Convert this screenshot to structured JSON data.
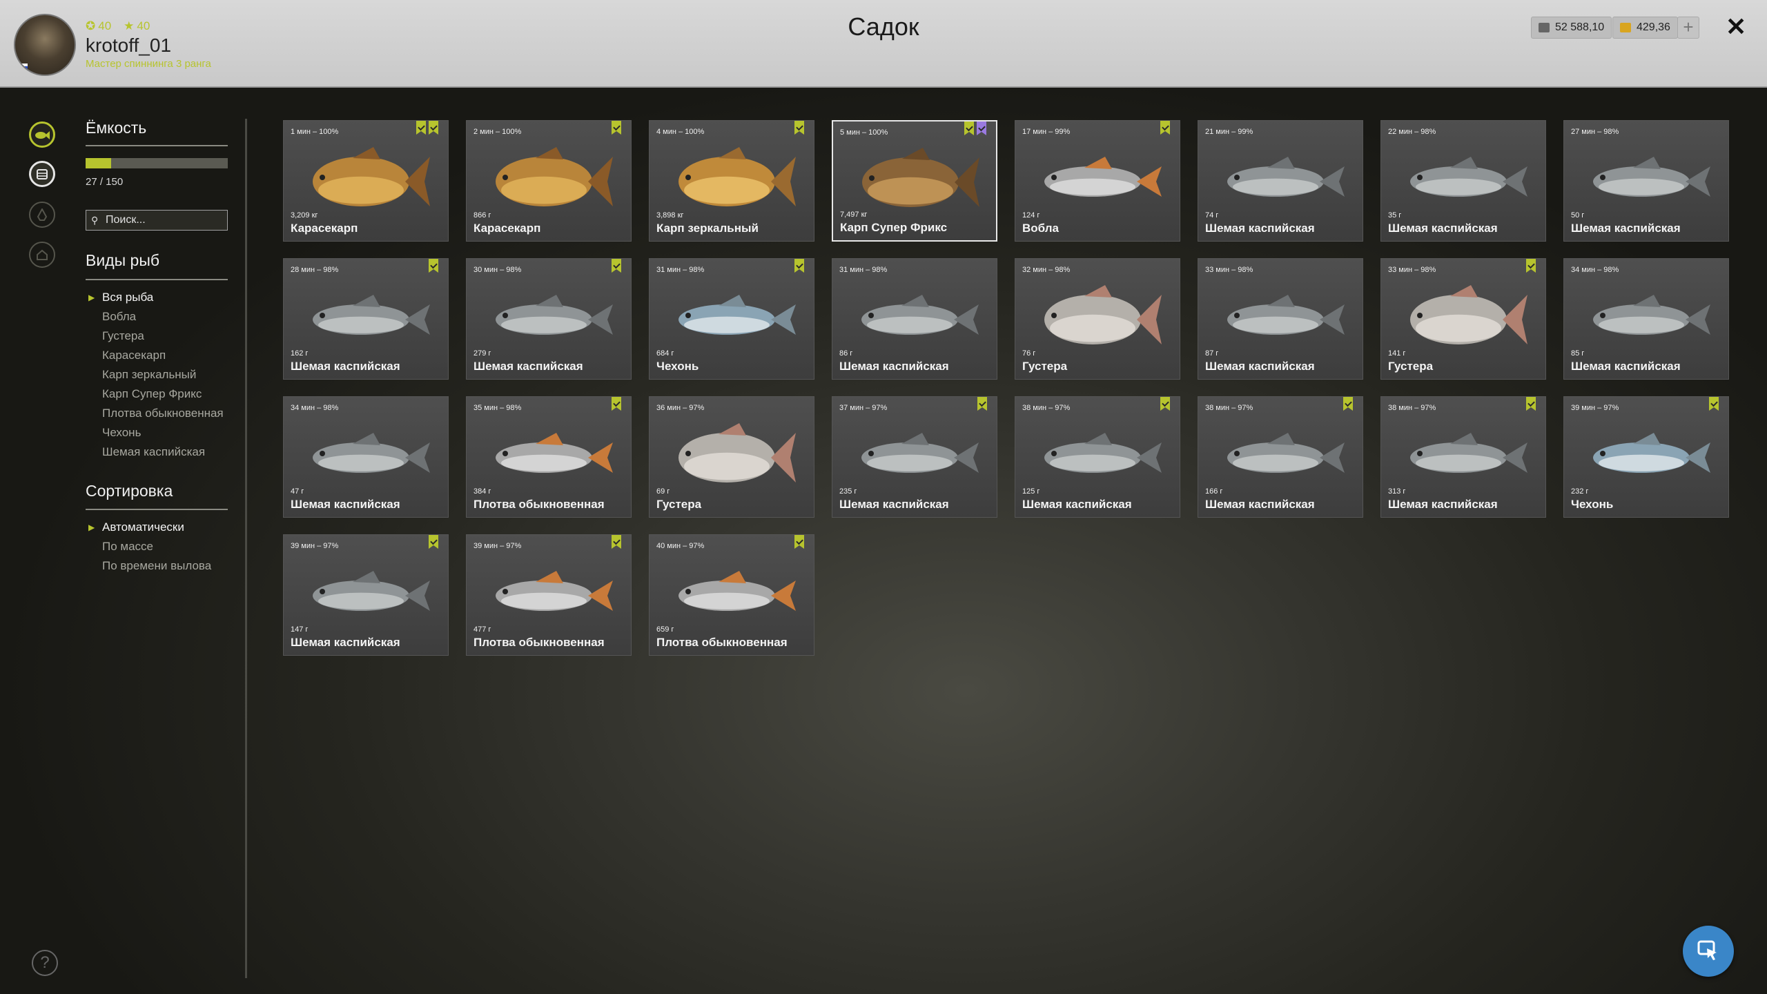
{
  "header": {
    "title": "Садок",
    "username": "krotoff_01",
    "rank": "Мастер спиннинга 3 ранга",
    "stat_level": "40",
    "stat_stars": "40",
    "silver": "52 588,10",
    "gold": "429,36",
    "plus_label": "+",
    "close_label": "✕"
  },
  "sidebar": {
    "capacity_title": "Ёмкость",
    "capacity_text": "27 / 150",
    "capacity_fraction": 0.18,
    "search_placeholder": "Поиск...",
    "species_title": "Виды рыб",
    "species": [
      {
        "label": "Вся рыба",
        "active": true
      },
      {
        "label": "Вобла",
        "active": false
      },
      {
        "label": "Густера",
        "active": false
      },
      {
        "label": "Карасекарп",
        "active": false
      },
      {
        "label": "Карп зеркальный",
        "active": false
      },
      {
        "label": "Карп Супер Фрикс",
        "active": false
      },
      {
        "label": "Плотва обыкновенная",
        "active": false
      },
      {
        "label": "Чехонь",
        "active": false
      },
      {
        "label": "Шемая каспийская",
        "active": false
      }
    ],
    "sort_title": "Сортировка",
    "sort": [
      {
        "label": "Автоматически",
        "active": true
      },
      {
        "label": "По массе",
        "active": false
      },
      {
        "label": "По времени вылова",
        "active": false
      }
    ]
  },
  "icons": {
    "rail": [
      "fish-icon",
      "keepnet-icon",
      "fire-icon",
      "home-icon"
    ],
    "help": "?",
    "fab": "cursor-icon"
  },
  "colors": {
    "accent": "#b7c42e",
    "badge_purple": "#9a7ae0",
    "fab": "#3a86c8"
  },
  "fish": [
    {
      "time": "1 мин – 100%",
      "weight": "3,209 кг",
      "name": "Карасекарп",
      "kind": "carp",
      "badges": [
        "green",
        "gold"
      ]
    },
    {
      "time": "2 мин – 100%",
      "weight": "866 г",
      "name": "Карасекарп",
      "kind": "carp",
      "badges": [
        "green"
      ]
    },
    {
      "time": "4 мин – 100%",
      "weight": "3,898 кг",
      "name": "Карп зеркальный",
      "kind": "mirror",
      "badges": [
        "green"
      ]
    },
    {
      "time": "5 мин – 100%",
      "weight": "7,497 кг",
      "name": "Карп Супер Фрикс",
      "kind": "frix",
      "badges": [
        "green",
        "purple"
      ],
      "selected": true
    },
    {
      "time": "17 мин – 99%",
      "weight": "124 г",
      "name": "Вобла",
      "kind": "roach",
      "badges": [
        "green"
      ]
    },
    {
      "time": "21 мин – 99%",
      "weight": "74 г",
      "name": "Шемая каспийская",
      "kind": "shemaya",
      "badges": []
    },
    {
      "time": "22 мин – 98%",
      "weight": "35 г",
      "name": "Шемая каспийская",
      "kind": "shemaya",
      "badges": []
    },
    {
      "time": "27 мин – 98%",
      "weight": "50 г",
      "name": "Шемая каспийская",
      "kind": "shemaya",
      "badges": []
    },
    {
      "time": "28 мин – 98%",
      "weight": "162 г",
      "name": "Шемая каспийская",
      "kind": "shemaya",
      "badges": [
        "green"
      ]
    },
    {
      "time": "30 мин – 98%",
      "weight": "279 г",
      "name": "Шемая каспийская",
      "kind": "shemaya",
      "badges": [
        "green"
      ]
    },
    {
      "time": "31 мин – 98%",
      "weight": "684 г",
      "name": "Чехонь",
      "kind": "chekhon",
      "badges": [
        "green"
      ]
    },
    {
      "time": "31 мин – 98%",
      "weight": "86 г",
      "name": "Шемая каспийская",
      "kind": "shemaya",
      "badges": []
    },
    {
      "time": "32 мин – 98%",
      "weight": "76 г",
      "name": "Густера",
      "kind": "bream",
      "badges": []
    },
    {
      "time": "33 мин – 98%",
      "weight": "87 г",
      "name": "Шемая каспийская",
      "kind": "shemaya",
      "badges": []
    },
    {
      "time": "33 мин – 98%",
      "weight": "141 г",
      "name": "Густера",
      "kind": "bream",
      "badges": [
        "green"
      ]
    },
    {
      "time": "34 мин – 98%",
      "weight": "85 г",
      "name": "Шемая каспийская",
      "kind": "shemaya",
      "badges": []
    },
    {
      "time": "34 мин – 98%",
      "weight": "47 г",
      "name": "Шемая каспийская",
      "kind": "shemaya",
      "badges": []
    },
    {
      "time": "35 мин – 98%",
      "weight": "384 г",
      "name": "Плотва обыкновенная",
      "kind": "roach",
      "badges": [
        "green"
      ]
    },
    {
      "time": "36 мин – 97%",
      "weight": "69 г",
      "name": "Густера",
      "kind": "bream",
      "badges": []
    },
    {
      "time": "37 мин – 97%",
      "weight": "235 г",
      "name": "Шемая каспийская",
      "kind": "shemaya",
      "badges": [
        "green"
      ]
    },
    {
      "time": "38 мин – 97%",
      "weight": "125 г",
      "name": "Шемая каспийская",
      "kind": "shemaya",
      "badges": [
        "green"
      ]
    },
    {
      "time": "38 мин – 97%",
      "weight": "166 г",
      "name": "Шемая каспийская",
      "kind": "shemaya",
      "badges": [
        "green"
      ]
    },
    {
      "time": "38 мин – 97%",
      "weight": "313 г",
      "name": "Шемая каспийская",
      "kind": "shemaya",
      "badges": [
        "green"
      ]
    },
    {
      "time": "39 мин – 97%",
      "weight": "232 г",
      "name": "Чехонь",
      "kind": "chekhon",
      "badges": [
        "green"
      ]
    },
    {
      "time": "39 мин – 97%",
      "weight": "147 г",
      "name": "Шемая каспийская",
      "kind": "shemaya",
      "badges": [
        "green"
      ]
    },
    {
      "time": "39 мин – 97%",
      "weight": "477 г",
      "name": "Плотва обыкновенная",
      "kind": "roach",
      "badges": [
        "green"
      ]
    },
    {
      "time": "40 мин – 97%",
      "weight": "659 г",
      "name": "Плотва обыкновенная",
      "kind": "roach",
      "badges": [
        "green"
      ]
    }
  ]
}
